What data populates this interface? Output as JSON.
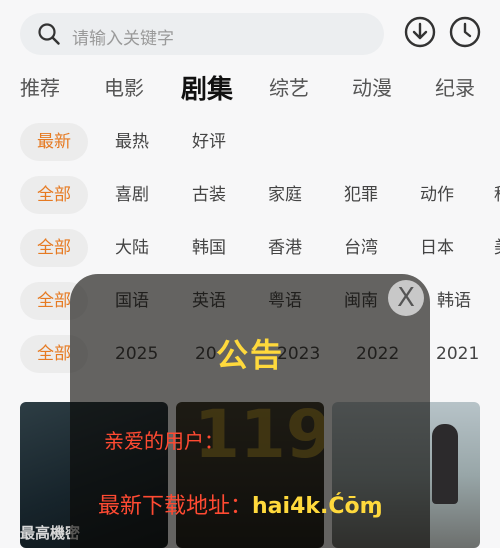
{
  "search": {
    "placeholder": "请输入关键字"
  },
  "tabs": [
    "推荐",
    "电影",
    "剧集",
    "综艺",
    "动漫",
    "纪录"
  ],
  "filters": {
    "sort": [
      "最新",
      "最热",
      "好评"
    ],
    "genre": [
      "全部",
      "喜剧",
      "古装",
      "家庭",
      "犯罪",
      "动作",
      "科"
    ],
    "region": [
      "全部",
      "大陆",
      "韩国",
      "香港",
      "台湾",
      "日本",
      "美"
    ],
    "language": [
      "全部",
      "国语",
      "英语",
      "粤语",
      "闽南",
      "韩语"
    ],
    "year": [
      "全部",
      "2025",
      "20",
      "2023",
      "2022",
      "2021"
    ]
  },
  "thumbs": {
    "first_caption": "最高機密",
    "second_big_text": "119"
  },
  "notice": {
    "title": "公告",
    "close": "X",
    "greeting": "亲爱的用户：",
    "address_label": "最新下载地址：",
    "address_url": "hai4k.Ćōɱ"
  },
  "colors": {
    "accent": "#e67a22",
    "notice_yellow": "#ffd93c",
    "notice_red": "#ff4a32"
  }
}
